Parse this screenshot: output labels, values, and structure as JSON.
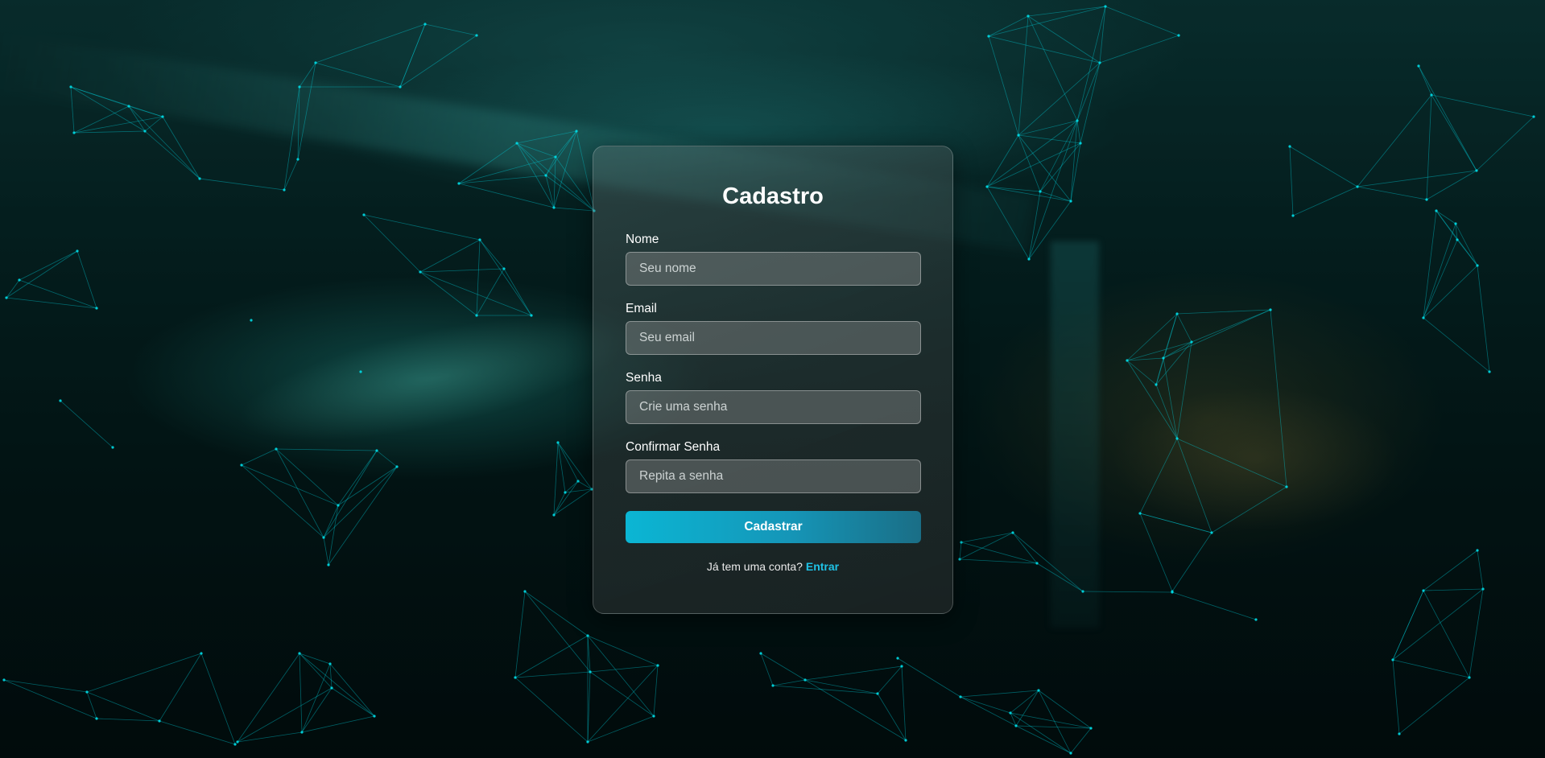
{
  "form": {
    "title": "Cadastro",
    "fields": [
      {
        "label": "Nome",
        "placeholder": "Seu nome",
        "value": ""
      },
      {
        "label": "Email",
        "placeholder": "Seu email",
        "value": ""
      },
      {
        "label": "Senha",
        "placeholder": "Crie uma senha",
        "value": ""
      },
      {
        "label": "Confirmar Senha",
        "placeholder": "Repita a senha",
        "value": ""
      }
    ],
    "submit_label": "Cadastrar",
    "footer_text": "Já tem uma conta?",
    "footer_link": "Entrar"
  },
  "colors": {
    "accent": "#0bb6d4",
    "link": "#1fc2e6",
    "network": "#00c8d2"
  }
}
